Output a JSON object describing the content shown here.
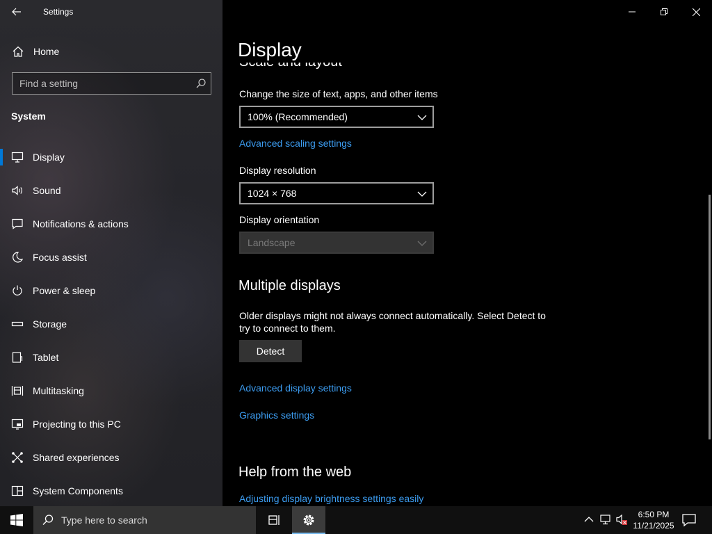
{
  "window": {
    "title": "Settings"
  },
  "sidebar": {
    "home_label": "Home",
    "search_placeholder": "Find a setting",
    "section": "System",
    "items": [
      {
        "label": "Display",
        "icon": "monitor-icon",
        "active": true
      },
      {
        "label": "Sound",
        "icon": "speaker-icon"
      },
      {
        "label": "Notifications & actions",
        "icon": "message-icon"
      },
      {
        "label": "Focus assist",
        "icon": "moon-icon"
      },
      {
        "label": "Power & sleep",
        "icon": "power-icon"
      },
      {
        "label": "Storage",
        "icon": "storage-icon"
      },
      {
        "label": "Tablet",
        "icon": "tablet-icon"
      },
      {
        "label": "Multitasking",
        "icon": "multitasking-icon"
      },
      {
        "label": "Projecting to this PC",
        "icon": "projecting-icon"
      },
      {
        "label": "Shared experiences",
        "icon": "shared-experiences-icon"
      },
      {
        "label": "System Components",
        "icon": "components-icon"
      }
    ]
  },
  "main": {
    "page_title": "Display",
    "cut_heading": "Scale and layout",
    "scale": {
      "label": "Change the size of text, apps, and other items",
      "value": "100% (Recommended)",
      "advanced_link": "Advanced scaling settings"
    },
    "resolution": {
      "label": "Display resolution",
      "value": "1024 × 768"
    },
    "orientation": {
      "label": "Display orientation",
      "value": "Landscape",
      "disabled": true
    },
    "multiple_displays": {
      "heading": "Multiple displays",
      "description": "Older displays might not always connect automatically. Select Detect to try to connect to them.",
      "detect_label": "Detect",
      "advanced_display_link": "Advanced display settings",
      "graphics_link": "Graphics settings"
    },
    "help": {
      "heading": "Help from the web",
      "link": "Adjusting display brightness settings easily"
    }
  },
  "taskbar": {
    "search_placeholder": "Type here to search",
    "time": "6:50 PM",
    "date": "11/21/2025"
  },
  "colors": {
    "accent": "#0078d7",
    "link": "#3c9cf0",
    "sidebar_bg": "#26262b",
    "main_bg": "#000000",
    "taskbar_bg": "#101010"
  }
}
